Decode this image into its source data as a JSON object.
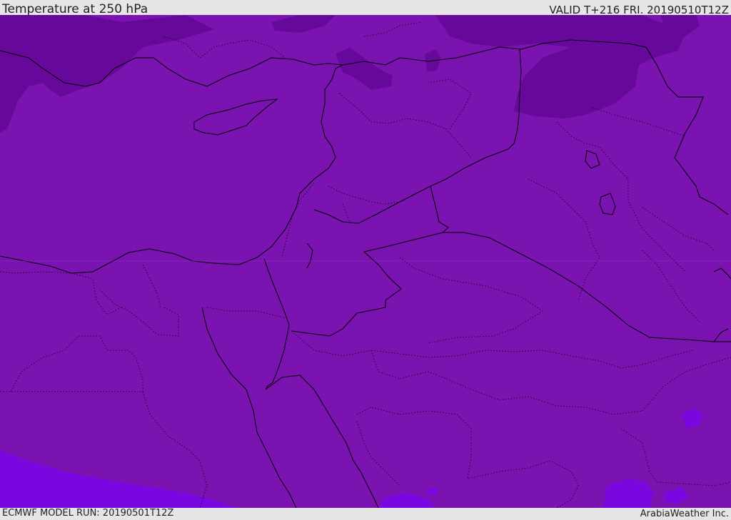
{
  "header": {
    "title": "Temperature at 250 hPa",
    "valid": "VALID T+216 FRI. 20190510T12Z"
  },
  "footer": {
    "model_run": "ECMWF MODEL RUN: 20190501T12Z",
    "credit": "ArabiaWeather Inc."
  },
  "colors": {
    "background_field": "#7a13b0",
    "colder_field": "#66089a",
    "warmer_field": "#7a06e0",
    "border_line": "#000000"
  }
}
